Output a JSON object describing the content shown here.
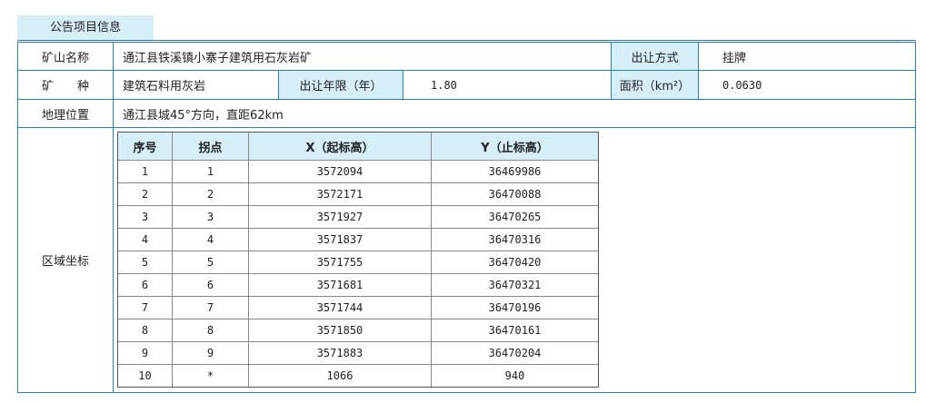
{
  "tab_title": "公告项目信息",
  "row1": {
    "label": "矿山名称",
    "value": "通江县铁溪镇小寨子建筑用石灰岩矿",
    "label2": "出让方式",
    "value2": "挂牌"
  },
  "row2": {
    "label": "矿　　种",
    "value": "建筑石料用灰岩",
    "label2": "出让年限（年）",
    "value2": "1.80",
    "label3": "面积（km²）",
    "value3": "0.0630"
  },
  "row3": {
    "label": "地理位置",
    "value": "通江县城45°方向，直距62km"
  },
  "row4": {
    "label": "区域坐标"
  },
  "coord_table": {
    "headers": [
      "序号",
      "拐点",
      "X（起标高）",
      "Y（止标高）"
    ],
    "rows": [
      [
        "1",
        "1",
        "3572094",
        "36469986"
      ],
      [
        "2",
        "2",
        "3572171",
        "36470088"
      ],
      [
        "3",
        "3",
        "3571927",
        "36470265"
      ],
      [
        "4",
        "4",
        "3571837",
        "36470316"
      ],
      [
        "5",
        "5",
        "3571755",
        "36470420"
      ],
      [
        "6",
        "6",
        "3571681",
        "36470321"
      ],
      [
        "7",
        "7",
        "3571744",
        "36470196"
      ],
      [
        "8",
        "8",
        "3571850",
        "36470161"
      ],
      [
        "9",
        "9",
        "3571883",
        "36470204"
      ],
      [
        "10",
        "*",
        "1066",
        "940"
      ]
    ]
  }
}
